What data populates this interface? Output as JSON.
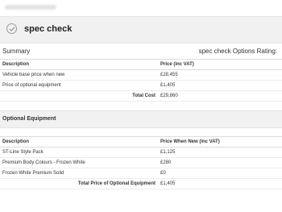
{
  "header": {
    "title": "spec check"
  },
  "summary": {
    "label": "Summary",
    "rating_label": "spec check Options Rating: ",
    "columns": [
      "Description",
      "Price (inc VAT)"
    ],
    "rows": [
      {
        "description": "Vehicle base price when new",
        "price": "£28,455"
      },
      {
        "description": "Price of optional equipment",
        "price": "£1,405"
      }
    ],
    "total_label": "Total Cost",
    "total_value": "£29,860"
  },
  "equipment": {
    "title": "Optional Equipment",
    "columns": [
      "Description",
      "Price When New (inc VAT)"
    ],
    "rows": [
      {
        "description": "ST-Line Style Pack",
        "price": "£1,125"
      },
      {
        "description": "Premium Body Colours - Frozen White",
        "price": "£280"
      },
      {
        "description": "Frozen White Premium Solid",
        "price": "£0"
      }
    ],
    "total_label": "Total Price of Optional Equipment",
    "total_value": "£1,405"
  }
}
